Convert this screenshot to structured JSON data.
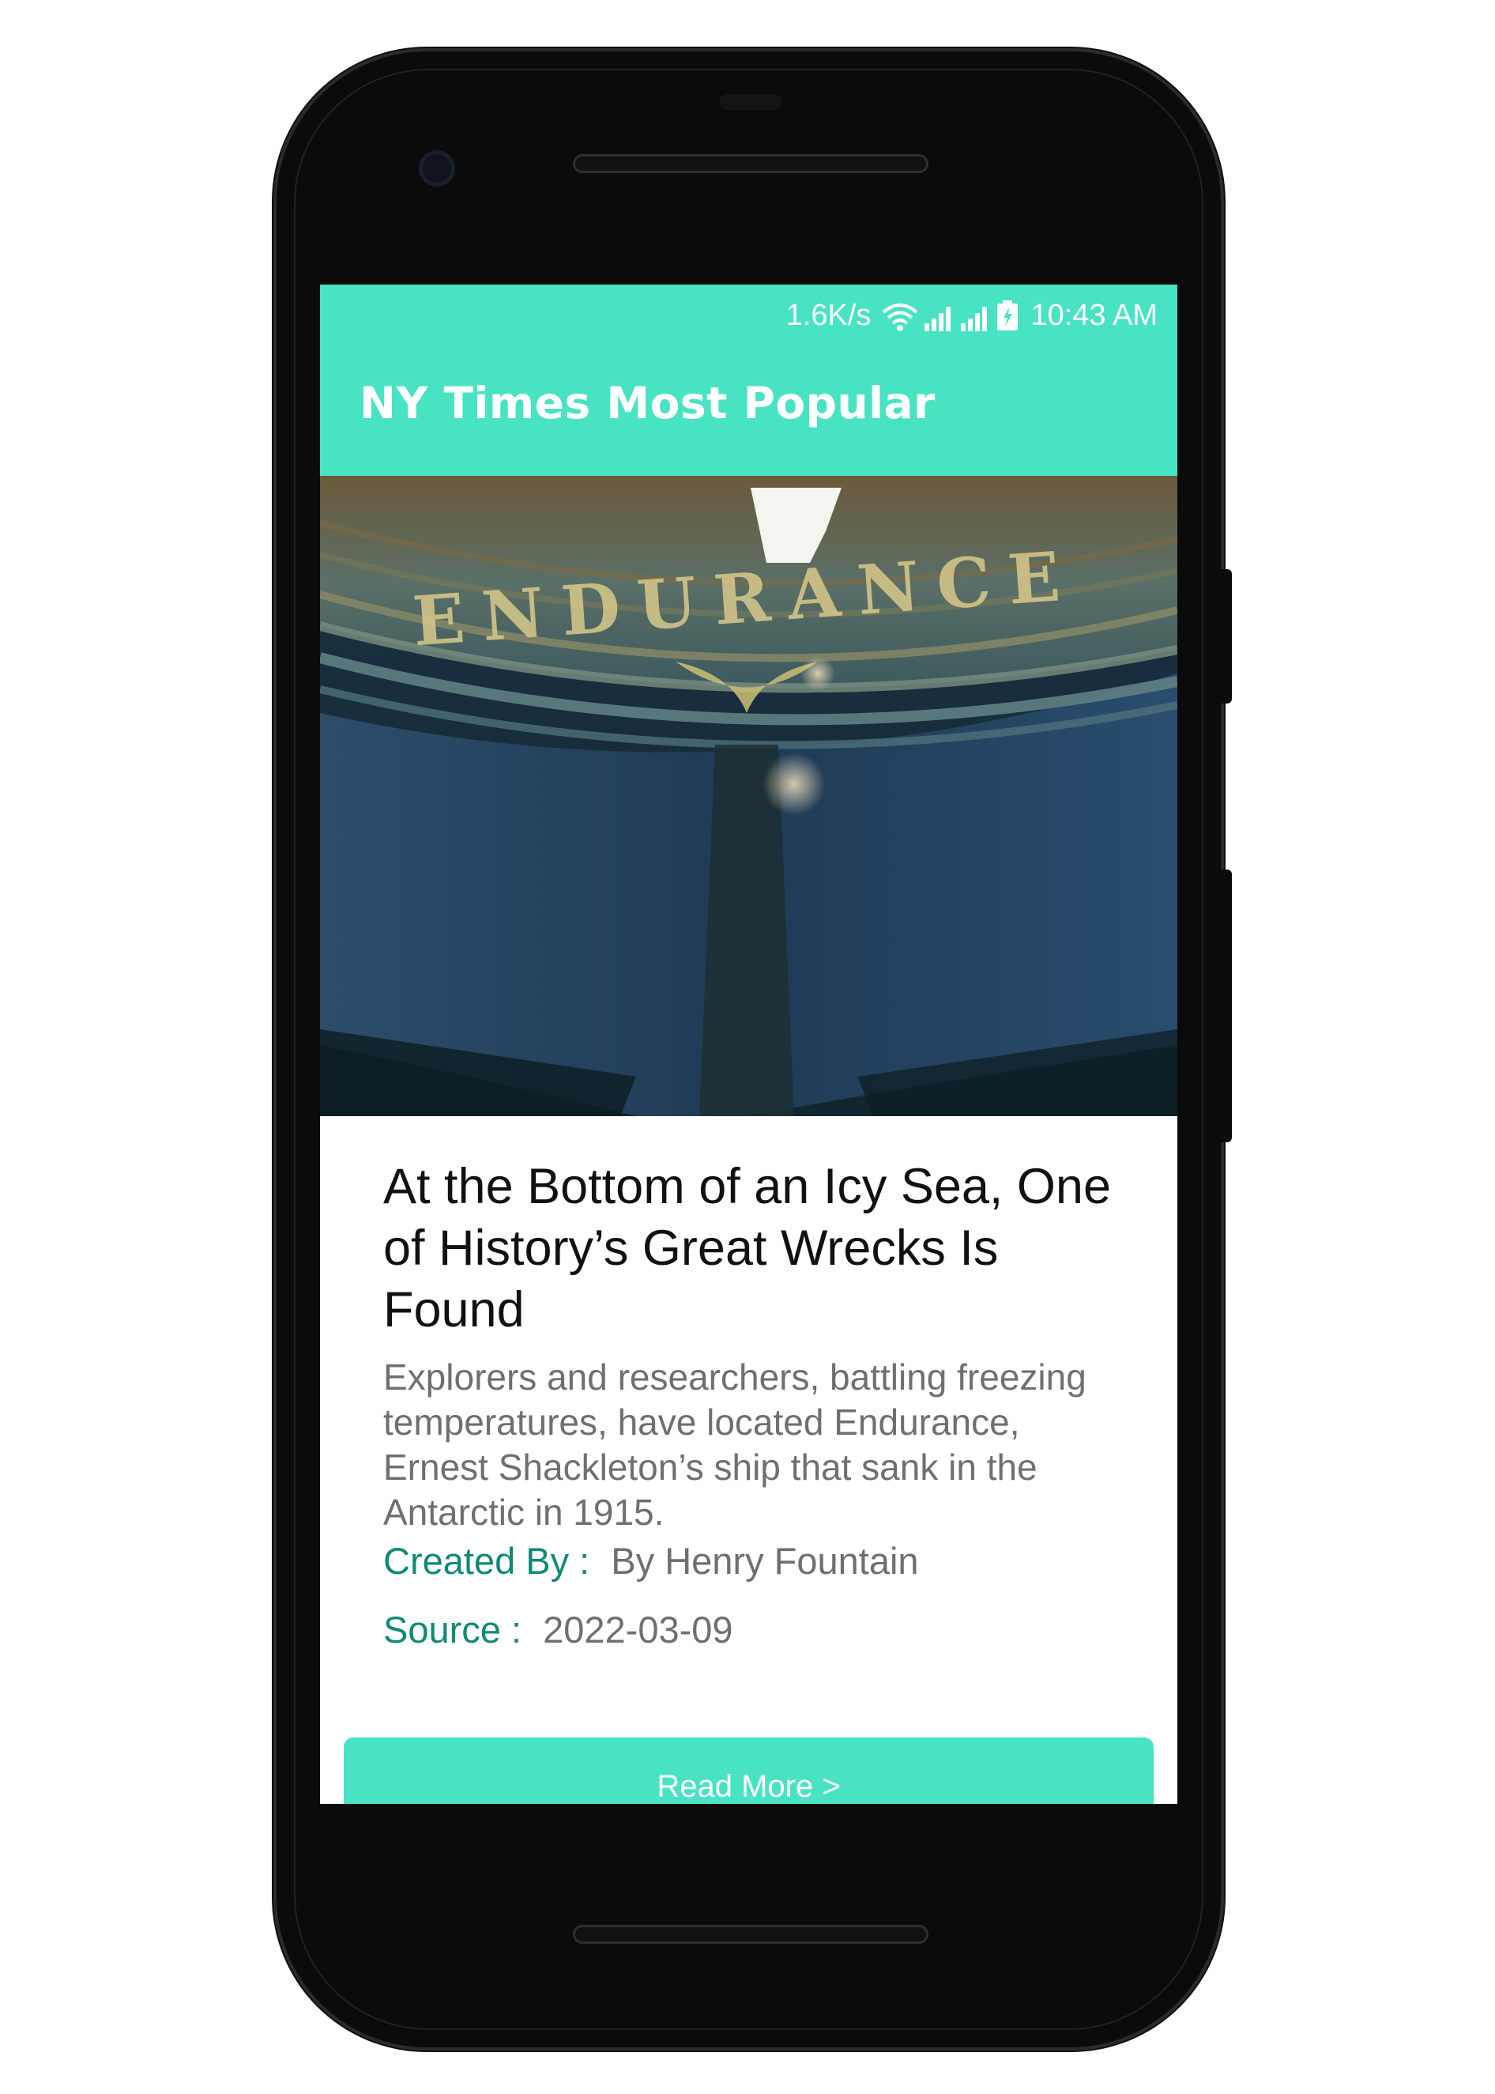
{
  "status_bar": {
    "network_speed": "1.6K/s",
    "time": "10:43 AM",
    "icons": [
      "wifi-icon",
      "signal-icon",
      "signal-icon",
      "battery-charging-icon"
    ]
  },
  "app_bar": {
    "title": "NY Times Most Popular"
  },
  "article": {
    "image": {
      "icon": "shipwreck-photo",
      "stern_lettering": "ENDURANCE"
    },
    "headline": "At the Bottom of an Icy Sea, One of History’s Great Wrecks Is Found",
    "abstract": "Explorers and researchers, battling freezing temperatures, have located Endurance, Ernest Shackleton’s ship that sank in the Antarctic in 1915.",
    "byline_label": "Created By :",
    "byline_value": "By Henry Fountain",
    "source_label": "Source :",
    "source_value": "2022-03-09",
    "read_more_label": "Read More >"
  },
  "colors": {
    "accent": "#48e3c3",
    "label_teal": "#0f8a76",
    "secondary_text": "#6f6f6f",
    "device_body": "#0b0b0b"
  }
}
